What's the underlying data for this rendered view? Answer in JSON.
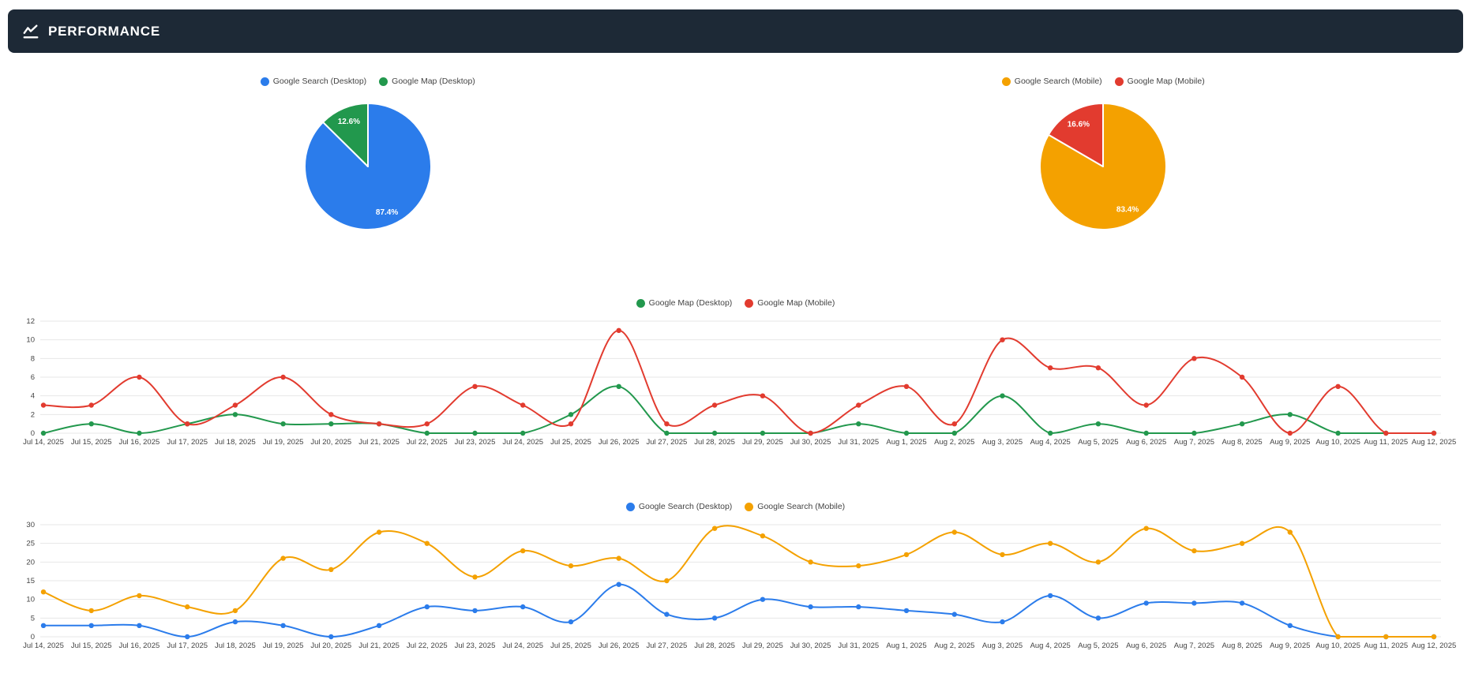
{
  "header": {
    "title": "PERFORMANCE"
  },
  "colors": {
    "header_bg": "#1d2936",
    "blue": "#2b7ceb",
    "green": "#22984d",
    "orange": "#f4a100",
    "red": "#e23b2f",
    "grid": "#e7e7e7",
    "axis_text": "#444444",
    "pie_label_text": "#ffffff"
  },
  "dates": [
    "Jul 14, 2025",
    "Jul 15, 2025",
    "Jul 16, 2025",
    "Jul 17, 2025",
    "Jul 18, 2025",
    "Jul 19, 2025",
    "Jul 20, 2025",
    "Jul 21, 2025",
    "Jul 22, 2025",
    "Jul 23, 2025",
    "Jul 24, 2025",
    "Jul 25, 2025",
    "Jul 26, 2025",
    "Jul 27, 2025",
    "Jul 28, 2025",
    "Jul 29, 2025",
    "Jul 30, 2025",
    "Jul 31, 2025",
    "Aug 1, 2025",
    "Aug 2, 2025",
    "Aug 3, 2025",
    "Aug 4, 2025",
    "Aug 5, 2025",
    "Aug 6, 2025",
    "Aug 7, 2025",
    "Aug 8, 2025",
    "Aug 9, 2025",
    "Aug 10, 2025",
    "Aug 11, 2025",
    "Aug 12, 2025"
  ],
  "chart_data": [
    {
      "type": "pie",
      "name": "desktop-clicks-share",
      "legend_position": "top",
      "slices": [
        {
          "label": "Google Search (Desktop)",
          "value": 87.4,
          "display": "87.4%",
          "color_key": "blue"
        },
        {
          "label": "Google Map (Desktop)",
          "value": 12.6,
          "display": "12.6%",
          "color_key": "green"
        }
      ]
    },
    {
      "type": "pie",
      "name": "mobile-clicks-share",
      "legend_position": "top",
      "slices": [
        {
          "label": "Google Search (Mobile)",
          "value": 83.4,
          "display": "83.4%",
          "color_key": "orange"
        },
        {
          "label": "Google Map (Mobile)",
          "value": 16.6,
          "display": "16.6%",
          "color_key": "red"
        }
      ]
    },
    {
      "type": "line",
      "name": "google-map-clicks",
      "legend_position": "top",
      "grid": true,
      "ylim": [
        0,
        12
      ],
      "yticks": [
        0,
        2,
        4,
        6,
        8,
        10,
        12
      ],
      "x": [
        "Jul 14, 2025",
        "Jul 15, 2025",
        "Jul 16, 2025",
        "Jul 17, 2025",
        "Jul 18, 2025",
        "Jul 19, 2025",
        "Jul 20, 2025",
        "Jul 21, 2025",
        "Jul 22, 2025",
        "Jul 23, 2025",
        "Jul 24, 2025",
        "Jul 25, 2025",
        "Jul 26, 2025",
        "Jul 27, 2025",
        "Jul 28, 2025",
        "Jul 29, 2025",
        "Jul 30, 2025",
        "Jul 31, 2025",
        "Aug 1, 2025",
        "Aug 2, 2025",
        "Aug 3, 2025",
        "Aug 4, 2025",
        "Aug 5, 2025",
        "Aug 6, 2025",
        "Aug 7, 2025",
        "Aug 8, 2025",
        "Aug 9, 2025",
        "Aug 10, 2025",
        "Aug 11, 2025",
        "Aug 12, 2025"
      ],
      "series": [
        {
          "name": "Google Map (Desktop)",
          "color_key": "green",
          "values": [
            0,
            1,
            0,
            1,
            2,
            1,
            1,
            1,
            0,
            0,
            0,
            2,
            5,
            0,
            0,
            0,
            0,
            1,
            0,
            0,
            4,
            0,
            1,
            0,
            0,
            1,
            2,
            0,
            0,
            0
          ]
        },
        {
          "name": "Google Map (Mobile)",
          "color_key": "red",
          "values": [
            3,
            3,
            6,
            1,
            3,
            6,
            2,
            1,
            1,
            5,
            3,
            1,
            11,
            1,
            3,
            4,
            0,
            3,
            5,
            1,
            10,
            7,
            7,
            3,
            8,
            6,
            0,
            5,
            0,
            0
          ]
        }
      ]
    },
    {
      "type": "line",
      "name": "google-search-clicks",
      "legend_position": "top",
      "grid": true,
      "ylim": [
        0,
        30
      ],
      "yticks": [
        0,
        5,
        10,
        15,
        20,
        25,
        30
      ],
      "x": [
        "Jul 14, 2025",
        "Jul 15, 2025",
        "Jul 16, 2025",
        "Jul 17, 2025",
        "Jul 18, 2025",
        "Jul 19, 2025",
        "Jul 20, 2025",
        "Jul 21, 2025",
        "Jul 22, 2025",
        "Jul 23, 2025",
        "Jul 24, 2025",
        "Jul 25, 2025",
        "Jul 26, 2025",
        "Jul 27, 2025",
        "Jul 28, 2025",
        "Jul 29, 2025",
        "Jul 30, 2025",
        "Jul 31, 2025",
        "Aug 1, 2025",
        "Aug 2, 2025",
        "Aug 3, 2025",
        "Aug 4, 2025",
        "Aug 5, 2025",
        "Aug 6, 2025",
        "Aug 7, 2025",
        "Aug 8, 2025",
        "Aug 9, 2025",
        "Aug 10, 2025",
        "Aug 11, 2025",
        "Aug 12, 2025"
      ],
      "series": [
        {
          "name": "Google Search (Desktop)",
          "color_key": "blue",
          "values": [
            3,
            3,
            3,
            0,
            4,
            3,
            0,
            3,
            8,
            7,
            8,
            4,
            14,
            6,
            5,
            10,
            8,
            8,
            7,
            6,
            4,
            11,
            5,
            9,
            9,
            9,
            3,
            0,
            0,
            0
          ]
        },
        {
          "name": "Google Search (Mobile)",
          "color_key": "orange",
          "values": [
            12,
            7,
            11,
            8,
            7,
            21,
            18,
            28,
            25,
            16,
            23,
            19,
            21,
            15,
            29,
            27,
            20,
            19,
            22,
            28,
            22,
            25,
            20,
            29,
            23,
            25,
            28,
            0,
            0,
            0
          ]
        }
      ]
    }
  ]
}
